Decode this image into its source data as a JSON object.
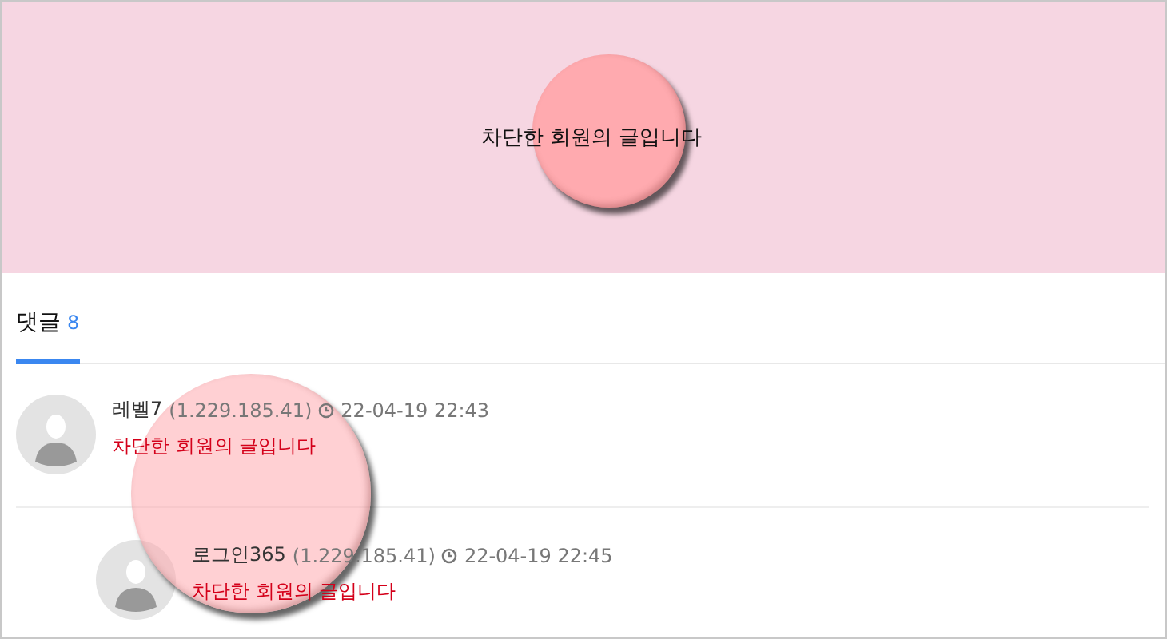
{
  "banner": {
    "message": "차단한 회원의 글입니다"
  },
  "comments_tab": {
    "label": "댓글",
    "count": "8",
    "selected": true
  },
  "comments": [
    {
      "author": "레벨7",
      "ip": "(1.229.185.41)",
      "time": "22-04-19 22:43",
      "body": "차단한 회원의 글입니다",
      "children": [
        {
          "author": "로그인365",
          "ip": "(1.229.185.41)",
          "time": "22-04-19 22:45",
          "body": "차단한 회원의 글입니다"
        }
      ]
    }
  ]
}
